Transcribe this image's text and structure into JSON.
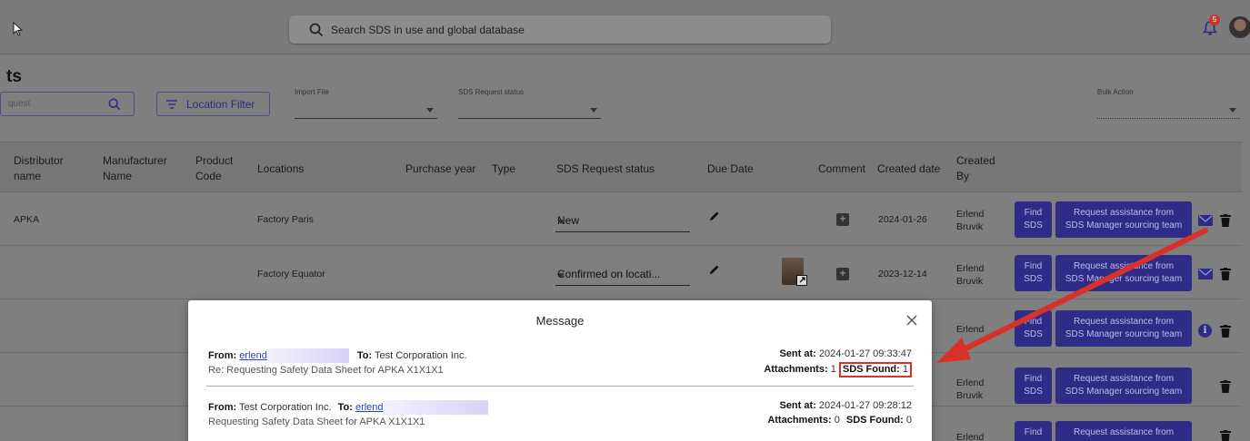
{
  "topbar": {
    "search_placeholder": "Search SDS in use and global database",
    "notification_count": "5"
  },
  "page": {
    "title": "ts",
    "search_placeholder": "quest",
    "location_filter_label": "Location Filter",
    "import_file_label": "Import File",
    "sds_request_status_label": "SDS Request status",
    "bulk_action_label": "Bulk Action"
  },
  "table": {
    "headers": {
      "distributor": "Distributor name",
      "manufacturer": "Manufacturer Name",
      "product_code": "Product Code",
      "locations": "Locations",
      "purchase_year": "Purchase year",
      "type": "Type",
      "status": "SDS Request status",
      "due_date": "Due Date",
      "comment": "Comment",
      "created_date": "Created date",
      "created_by": "Created By"
    },
    "rows": [
      {
        "distributor": "APKA",
        "location": "Factory Paris",
        "status": "New",
        "created_date": "2024-01-26",
        "created_by": "Erlend Bruvik"
      },
      {
        "distributor": "",
        "location": "Factory Equator",
        "status": "Confirmed on locati...",
        "created_date": "2023-12-14",
        "created_by": "Erlend Bruvik"
      },
      {
        "distributor": "",
        "location": "",
        "status": "",
        "created_date": "",
        "created_by": "Erlend"
      },
      {
        "distributor": "",
        "location": "",
        "status": "",
        "created_date": "",
        "created_by": "Erlend Bruvik"
      },
      {
        "distributor": "",
        "location": "",
        "status": "",
        "created_date": "",
        "created_by": "Erlend"
      }
    ],
    "find_label_1": "Find",
    "find_label_2": "SDS",
    "assist_label_1": "Request assistance from",
    "assist_label_2": "SDS Manager sourcing team"
  },
  "modal": {
    "title": "Message",
    "messages": [
      {
        "from_label": "From:",
        "from_value": "erlend",
        "to_label": "To:",
        "to_value": "Test Corporation Inc.",
        "subject": "Re: Requesting Safety Data Sheet for APKA X1X1X1",
        "sent_label": "Sent at:",
        "sent_value": "2024-01-27 09:33:47",
        "attachments_label": "Attachments:",
        "attachments_value": "1",
        "sds_found_label": "SDS Found:",
        "sds_found_value": "1"
      },
      {
        "from_label": "From:",
        "from_value": "Test Corporation Inc.",
        "to_label": "To:",
        "to_value": "erlend",
        "subject": "Requesting Safety Data Sheet for APKA X1X1X1",
        "sent_label": "Sent at:",
        "sent_value": "2024-01-27 09:28:12",
        "attachments_label": "Attachments:",
        "attachments_value": "0",
        "sds_found_label": "SDS Found:",
        "sds_found_value": "0"
      }
    ]
  },
  "colors": {
    "primary": "#2f2c87",
    "annotation": "#d9302a",
    "overlay": "#7f7f7f"
  }
}
